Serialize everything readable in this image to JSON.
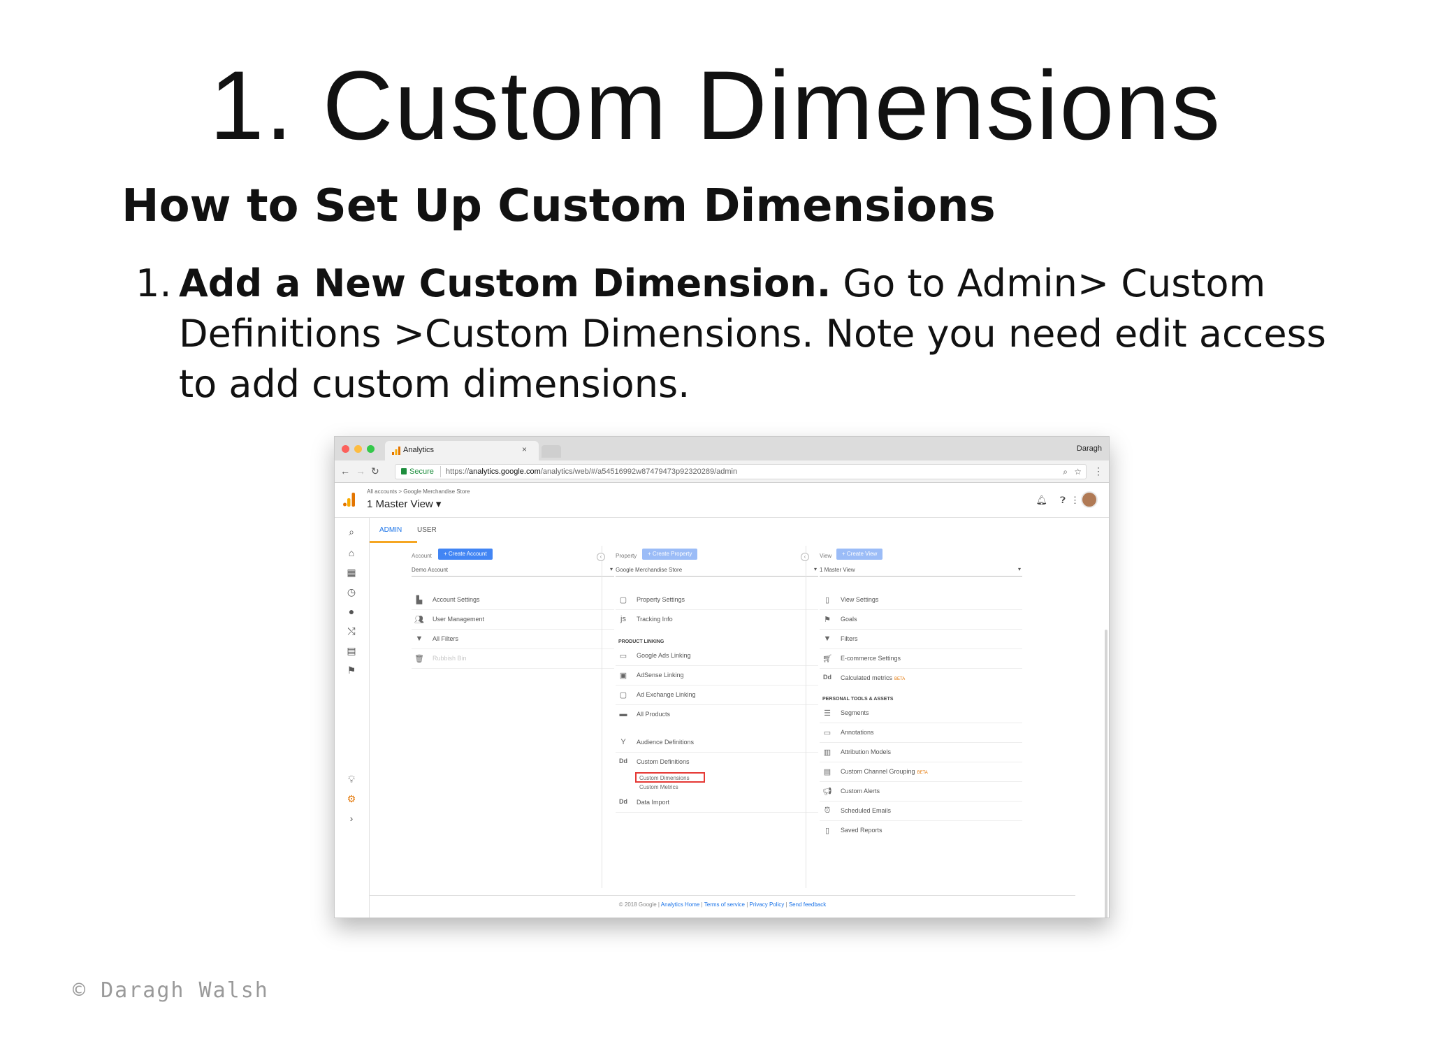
{
  "slide": {
    "title": "1. Custom Dimensions",
    "subtitle": "How to Set Up Custom Dimensions",
    "step_number": "1.",
    "step_bold": "Add a New Custom Dimension.",
    "step_text": " Go to Admin> Custom Definitions >Custom Dimensions. Note you need edit access to add custom dimensions.",
    "copyright": "© Daragh Walsh"
  },
  "browser": {
    "tab_title": "Analytics",
    "tab_close": "×",
    "profile_name": "Daragh",
    "secure_label": "Secure",
    "url_scheme": "https://",
    "url_host": "analytics.google.com",
    "url_path": "/analytics/web/#/a54516992w87479473p92320289/admin"
  },
  "ga": {
    "breadcrumb": "All accounts > Google Merchandise Store",
    "view_name": "1 Master View ▾",
    "tabs": {
      "admin": "ADMIN",
      "user": "USER"
    },
    "account": {
      "label": "Account",
      "create": "+ Create Account",
      "selected": "Demo Account",
      "items": [
        "Account Settings",
        "User Management",
        "All Filters",
        "Rubbish Bin"
      ]
    },
    "property": {
      "label": "Property",
      "create": "+ Create Property",
      "selected": "Google Merchandise Store",
      "items_top": [
        "Property Settings",
        "Tracking Info"
      ],
      "section": "PRODUCT LINKING",
      "items_linking": [
        "Google Ads Linking",
        "AdSense Linking",
        "Ad Exchange Linking",
        "All Products"
      ],
      "audience": "Audience Definitions",
      "custom_definitions": "Custom Definitions",
      "custom_dimensions": "Custom Dimensions",
      "custom_metrics": "Custom Metrics",
      "data_import": "Data Import"
    },
    "view": {
      "label": "View",
      "create": "+ Create View",
      "selected": "1 Master View",
      "items_top": [
        "View Settings",
        "Goals",
        "Filters",
        "E-commerce Settings",
        "Calculated metrics"
      ],
      "beta": "BETA",
      "section": "PERSONAL TOOLS & ASSETS",
      "items_personal": [
        "Segments",
        "Annotations",
        "Attribution Models",
        "Custom Channel Grouping",
        "Custom Alerts",
        "Scheduled Emails",
        "Saved Reports"
      ]
    },
    "footer": {
      "copyright": "© 2018 Google | ",
      "links": [
        "Analytics Home",
        "Terms of service",
        "Privacy Policy",
        "Send feedback"
      ],
      "sep": " | "
    }
  }
}
